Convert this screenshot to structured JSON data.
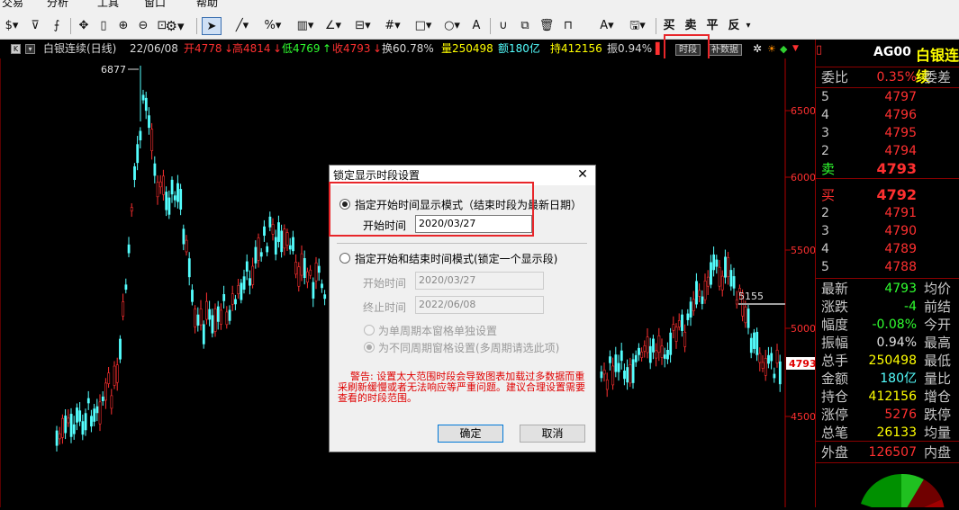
{
  "menubar": {
    "items": [
      "交易",
      "分析",
      "工具",
      "窗口",
      "帮助"
    ]
  },
  "toolbar": {
    "icons": [
      "dollar-icon",
      "filter-icon",
      "formula-icon",
      "move-icon",
      "cursor-bar-icon",
      "zoom-in-icon",
      "zoom-out-icon",
      "rect-zoom-icon",
      "settings-icon",
      "pointer-icon",
      "line-icon",
      "percent-icon",
      "bar-icon",
      "angle-icon",
      "channel-icon",
      "grid-icon",
      "rect-icon",
      "ellipse-icon",
      "text-icon",
      "magnet-icon",
      "copy-icon",
      "delete-icon",
      "lock-icon",
      "font-color-icon",
      "save-icon"
    ],
    "trade_buttons": [
      "买",
      "卖",
      "平",
      "反"
    ]
  },
  "infobar": {
    "symbol": "白银连续(日线)",
    "date": "22/06/08",
    "open_label": "开",
    "open": "4778",
    "high_label": "高",
    "high": "4814",
    "low_label": "低",
    "low": "4769",
    "close_label": "收",
    "close": "4793",
    "turnover_label": "换",
    "turnover": "60.78%",
    "volume_label": "量",
    "volume": "250498",
    "amount_label": "额",
    "amount": "180亿",
    "oi_label": "持",
    "oi": "412156",
    "amp_label": "振",
    "amp": "0.94%",
    "period_btn": "时段",
    "fill_btn": "补数据"
  },
  "chart": {
    "y_labels": [
      "6500",
      "6000",
      "5500",
      "5000",
      "4500"
    ],
    "peak_label": "6877",
    "ref_line_label": "5155",
    "last_price": "4793",
    "up_color": "#ff3030",
    "down_color": "#54ffff"
  },
  "quote": {
    "code": "AG00",
    "name": "白银连续",
    "ratio_label": "委比",
    "ratio": "0.35%",
    "diff_label": "委差",
    "asks": [
      {
        "level": "5",
        "price": "4797"
      },
      {
        "level": "4",
        "price": "4796"
      },
      {
        "level": "3",
        "price": "4795"
      },
      {
        "level": "2",
        "price": "4794"
      },
      {
        "level": "卖",
        "price": "4793"
      }
    ],
    "bids": [
      {
        "level": "买",
        "price": "4792"
      },
      {
        "level": "2",
        "price": "4791"
      },
      {
        "level": "3",
        "price": "4790"
      },
      {
        "level": "4",
        "price": "4789"
      },
      {
        "level": "5",
        "price": "4788"
      }
    ],
    "stats": [
      {
        "label": "最新",
        "value": "4793",
        "color": "#30ff30",
        "right": "均价"
      },
      {
        "label": "涨跌",
        "value": "-4",
        "color": "#30ff30",
        "right": "前结"
      },
      {
        "label": "幅度",
        "value": "-0.08%",
        "color": "#30ff30",
        "right": "今开"
      },
      {
        "label": "振幅",
        "value": "0.94%",
        "color": "#e0e0e0",
        "right": "最高"
      },
      {
        "label": "总手",
        "value": "250498",
        "color": "#ffff00",
        "right": "最低"
      },
      {
        "label": "金额",
        "value": "180亿",
        "color": "#54ffff",
        "right": "量比"
      },
      {
        "label": "持仓",
        "value": "412156",
        "color": "#ffff00",
        "right": "增仓"
      },
      {
        "label": "涨停",
        "value": "5276",
        "color": "#ff3030",
        "right": "跌停"
      },
      {
        "label": "总笔",
        "value": "26133",
        "color": "#ffff00",
        "right": "均量"
      }
    ],
    "outer_label": "外盘",
    "outer": "126507",
    "inner_label": "内盘"
  },
  "dialog": {
    "title": "锁定显示时段设置",
    "close": "✕",
    "mode1_label": "指定开始时间显示模式（结束时段为最新日期）",
    "start_label": "开始时间",
    "start_value": "2020/03/27",
    "mode2_label": "指定开始和结束时间模式(锁定一个显示段)",
    "start2_label": "开始时间",
    "start2_value": "2020/03/27",
    "end_label": "终止时间",
    "end_value": "2022/06/08",
    "opt_single": "为单周期本窗格单独设置",
    "opt_multi": "为不同周期窗格设置(多周期请选此项)",
    "warning": "警告: 设置太大范围时段会导致图表加载过多数据而重采刷新缓慢或者无法响应等严重问题。建议合理设置需要查看的时段范围。",
    "ok": "确定",
    "cancel": "取消"
  }
}
